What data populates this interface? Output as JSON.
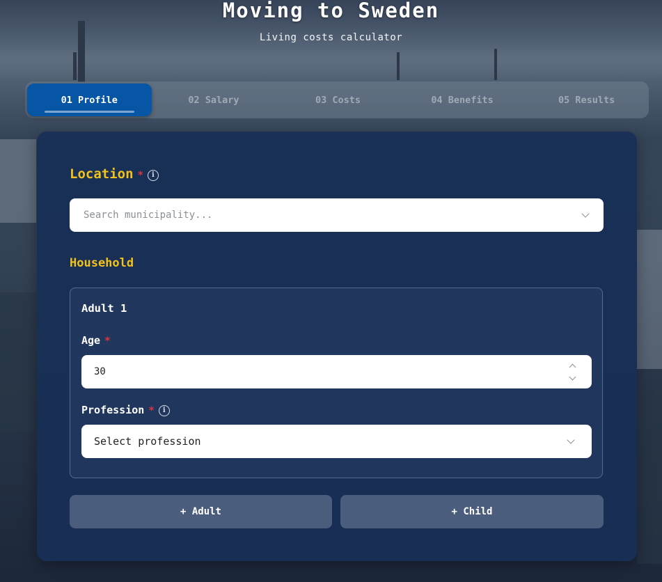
{
  "header": {
    "title": "Moving to Sweden",
    "subtitle": "Living costs calculator"
  },
  "tabs": [
    {
      "label": "01 Profile",
      "active": true
    },
    {
      "label": "02 Salary",
      "active": false
    },
    {
      "label": "03 Costs",
      "active": false
    },
    {
      "label": "04 Benefits",
      "active": false
    },
    {
      "label": "05 Results",
      "active": false
    }
  ],
  "location": {
    "title": "Location",
    "required_mark": "*",
    "info_icon": "i",
    "placeholder": "Search municipality..."
  },
  "household": {
    "title": "Household",
    "adult": {
      "title": "Adult 1",
      "age_label": "Age",
      "age_value": "30",
      "profession_label": "Profession",
      "profession_value": "Select profession"
    },
    "add_adult_label": "+ Adult",
    "add_child_label": "+ Child"
  },
  "colors": {
    "accent_yellow": "#f2c21b",
    "active_tab": "#0755a5",
    "card_bg": "#182e56",
    "required_red": "#e0343e"
  }
}
